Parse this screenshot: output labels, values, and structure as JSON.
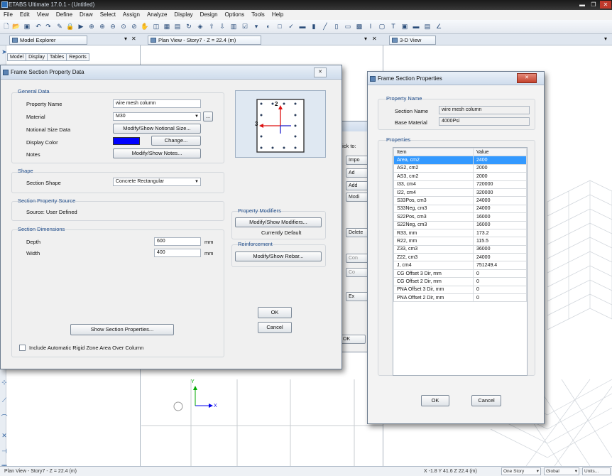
{
  "app": {
    "title": "ETABS Ultimate 17.0.1 - (Untitled)"
  },
  "menu": [
    "File",
    "Edit",
    "View",
    "Define",
    "Draw",
    "Select",
    "Assign",
    "Analyze",
    "Display",
    "Design",
    "Options",
    "Tools",
    "Help"
  ],
  "panels": {
    "explorer_tab": "Model Explorer",
    "plan_tab": "Plan View - Story7 - Z = 22.4 (m)",
    "view3d_tab": "3-D View",
    "close_glyph": "✕",
    "pin_glyph": "▾",
    "explorer_tabs": [
      "Model",
      "Display",
      "Tables",
      "Reports"
    ]
  },
  "plan_hidden_dialog": {
    "click_to": "Click to:",
    "buttons": [
      "Impo",
      "Ad",
      "Add",
      "Modi",
      "Delete",
      "Con",
      "Co",
      "Ex",
      "OK"
    ]
  },
  "frame_dialog": {
    "title": "Frame Section Property Data",
    "close": "✕",
    "general_data": "General Data",
    "property_name_label": "Property Name",
    "property_name_value": "wire mesh column",
    "material_label": "Material",
    "material_value": "M30",
    "material_more": "...",
    "notional_label": "Notional Size Data",
    "notional_btn": "Modify/Show Notional Size...",
    "display_color_label": "Display Color",
    "change_btn": "Change...",
    "display_color": "#0000ff",
    "notes_label": "Notes",
    "notes_btn": "Modify/Show Notes...",
    "shape": "Shape",
    "section_shape_label": "Section Shape",
    "section_shape_value": "Concrete Rectangular",
    "section_source": "Section Property Source",
    "source_value": "Source:  User Defined",
    "dimensions": "Section Dimensions",
    "depth_label": "Depth",
    "depth_value": "600",
    "width_label": "Width",
    "width_value": "400",
    "unit": "mm",
    "property_modifiers": "Property Modifiers",
    "modifiers_btn": "Modify/Show Modifiers...",
    "currently_default": "Currently Default",
    "reinforcement": "Reinforcement",
    "rebar_btn": "Modify/Show Rebar...",
    "show_props_btn": "Show Section Properties...",
    "ok": "OK",
    "cancel": "Cancel",
    "rigid_zone_label": "Include Automatic Rigid Zone Area Over Column",
    "preview_axis2": "2",
    "preview_axis3": "3"
  },
  "props_dialog": {
    "title": "Frame Section Properties",
    "close": "✕",
    "property_name": "Property Name",
    "section_name_label": "Section Name",
    "section_name_value": "wire mesh column",
    "base_material_label": "Base Material",
    "base_material_value": "4000Psi",
    "properties": "Properties",
    "col_item": "Item",
    "col_value": "Value",
    "rows": [
      {
        "item": "Area, cm2",
        "value": "2400"
      },
      {
        "item": "AS2, cm2",
        "value": "2000"
      },
      {
        "item": "AS3, cm2",
        "value": "2000"
      },
      {
        "item": "I33, cm4",
        "value": "720000"
      },
      {
        "item": "I22, cm4",
        "value": "320000"
      },
      {
        "item": "S33Pos, cm3",
        "value": "24000"
      },
      {
        "item": "S33Neg, cm3",
        "value": "24000"
      },
      {
        "item": "S22Pos, cm3",
        "value": "16000"
      },
      {
        "item": "S22Neg, cm3",
        "value": "16000"
      },
      {
        "item": "R33, mm",
        "value": "173.2"
      },
      {
        "item": "R22, mm",
        "value": "115.5"
      },
      {
        "item": "Z33, cm3",
        "value": "36000"
      },
      {
        "item": "Z22, cm3",
        "value": "24000"
      },
      {
        "item": "J, cm4",
        "value": "751249.4"
      },
      {
        "item": "CG Offset 3 Dir, mm",
        "value": "0"
      },
      {
        "item": "CG Offset 2 Dir, mm",
        "value": "0"
      },
      {
        "item": "PNA Offset 3 Dir, mm",
        "value": "0"
      },
      {
        "item": "PNA Offset 2 Dir, mm",
        "value": "0"
      }
    ],
    "ok": "OK",
    "cancel": "Cancel"
  },
  "plan_axes": {
    "x": "X",
    "y": "Y"
  },
  "status": {
    "left": "Plan View - Story7 - Z = 22.4 (m)",
    "coords": "X -1.8  Y 41.6  Z 22.4 (m)",
    "story": "One Story",
    "global": "Global",
    "units": "Units..."
  }
}
